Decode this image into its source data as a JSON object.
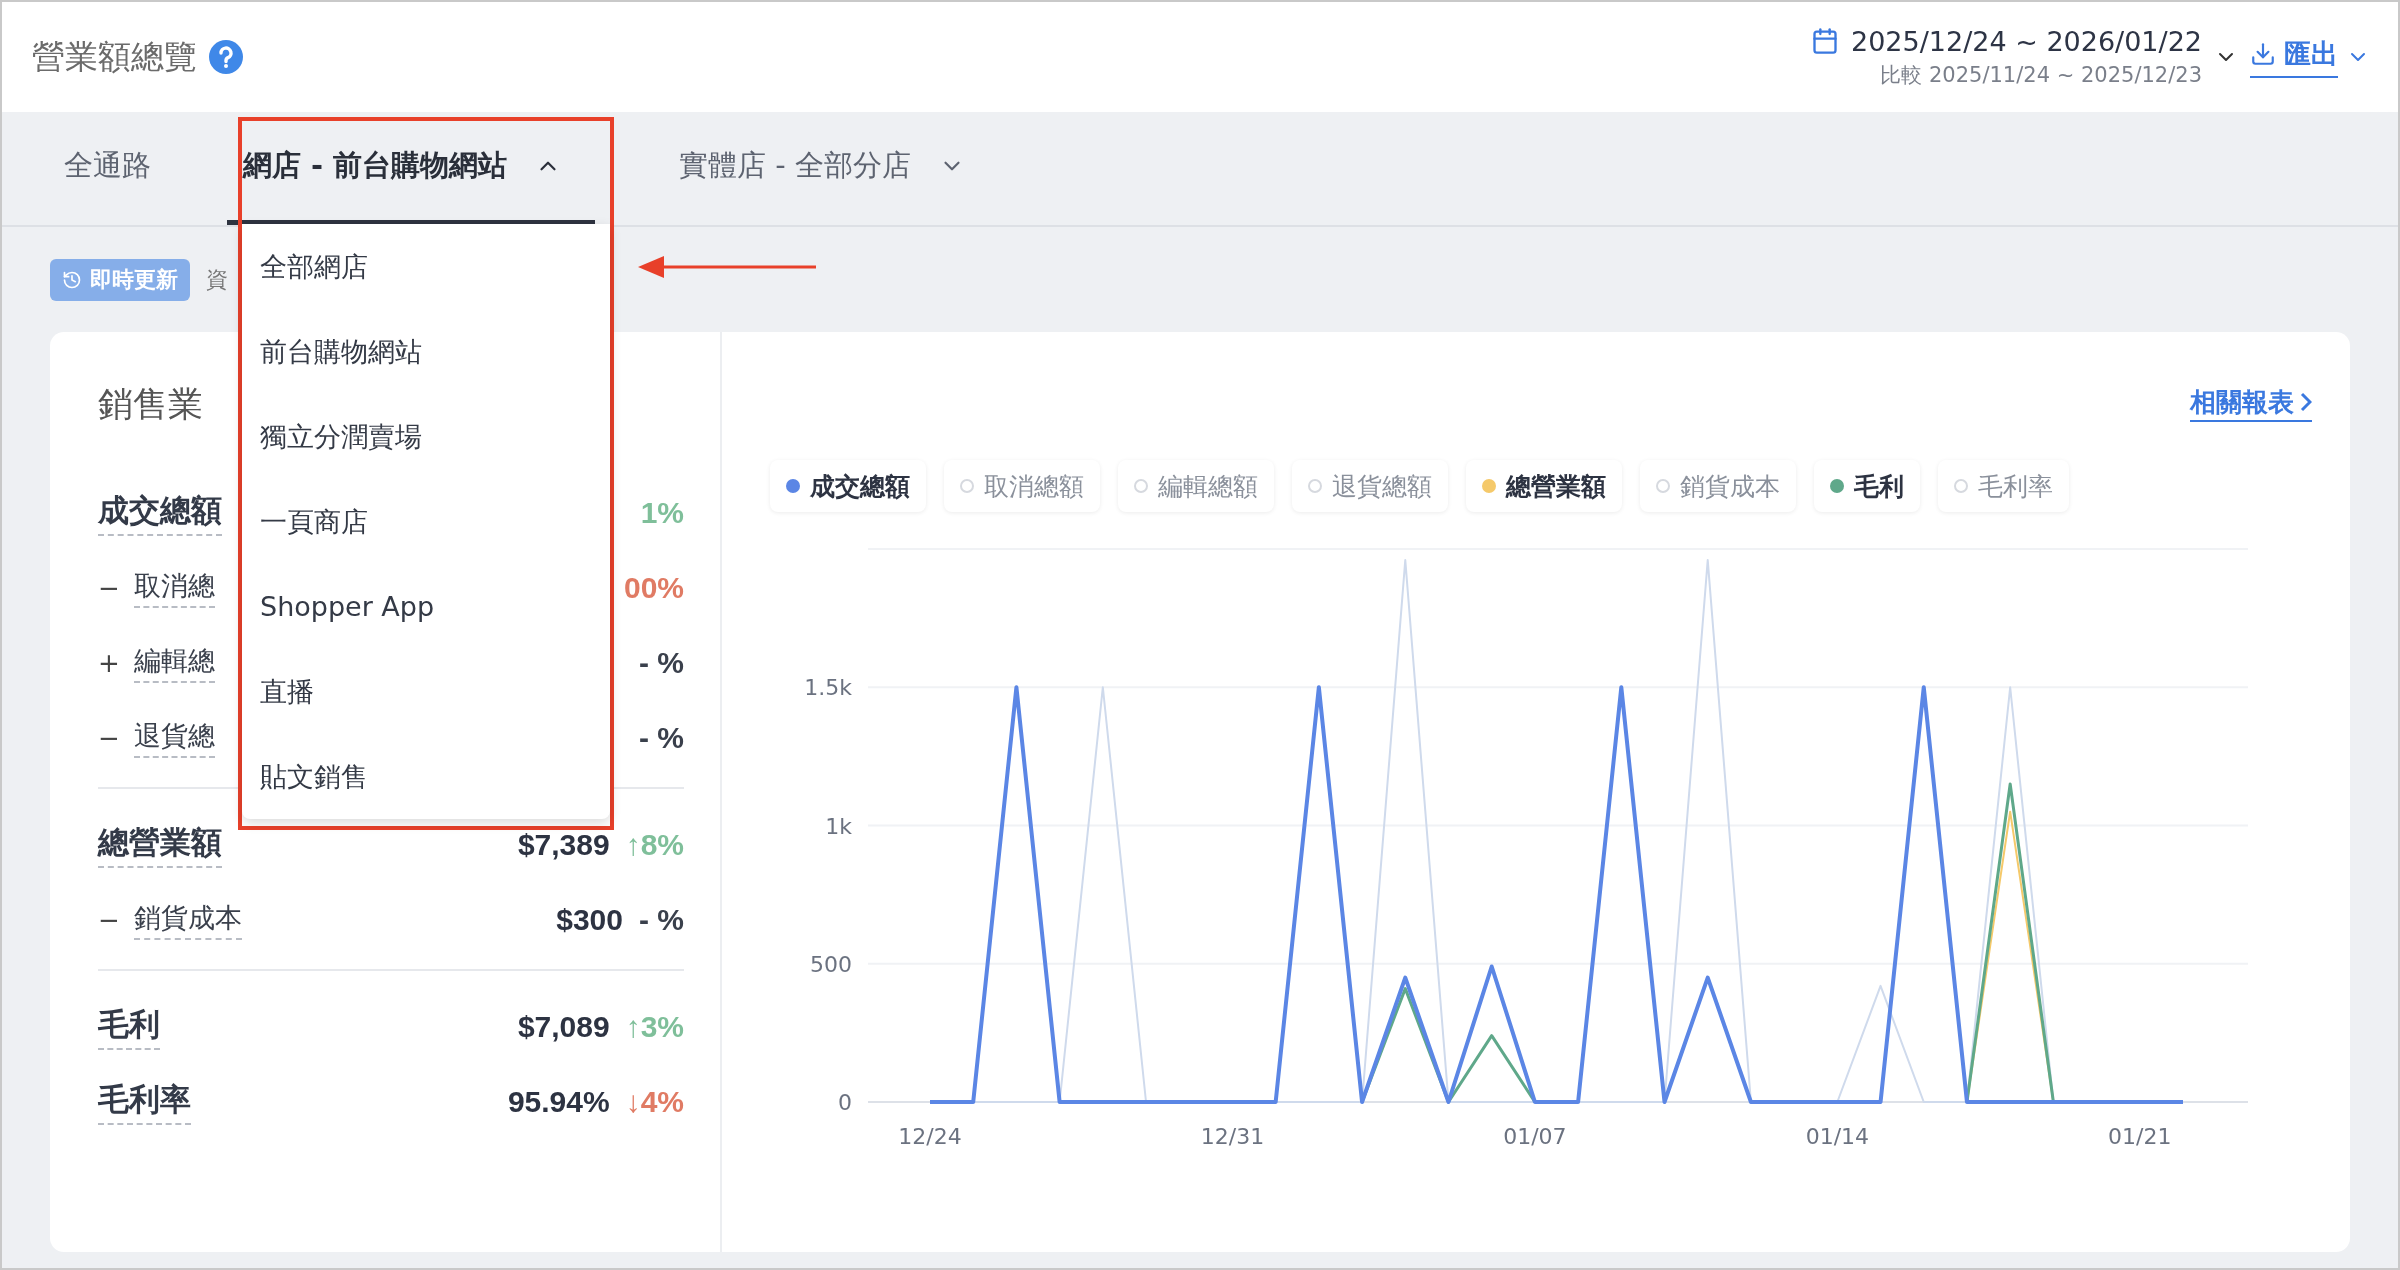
{
  "header": {
    "title": "營業額總覽",
    "date_range": "2025/12/24 ~ 2026/01/22",
    "compare": "比較 2025/11/24 ~ 2025/12/23",
    "export": "匯出"
  },
  "tabs": [
    {
      "label": "全通路",
      "selected": false
    },
    {
      "label": "網店 - 前台購物網站",
      "selected": true,
      "expanded": true
    },
    {
      "label": "實體店 - 全部分店",
      "selected": false,
      "expanded": false
    }
  ],
  "dropdown": {
    "items": [
      "全部網店",
      "前台購物網站",
      "獨立分潤賣場",
      "一頁商店",
      "Shopper App",
      "直播",
      "貼文銷售"
    ]
  },
  "status": {
    "badge": "即時更新",
    "text": "資"
  },
  "summary": {
    "title": "銷售業",
    "rows": [
      {
        "kind": "main",
        "label": "成交總額",
        "change": "1%",
        "color": "#7fbf9a"
      },
      {
        "kind": "sub",
        "sign": "−",
        "label": "取消總",
        "change": "00%",
        "color": "#e07b64"
      },
      {
        "kind": "sub",
        "sign": "+",
        "label": "編輯總",
        "change": "- %"
      },
      {
        "kind": "sub",
        "sign": "−",
        "label": "退貨總",
        "change": "- %"
      },
      {
        "kind": "divider"
      },
      {
        "kind": "main",
        "label": "總營業額",
        "value": "$7,389",
        "change": "↑8%",
        "color": "#7fbf9a"
      },
      {
        "kind": "sub",
        "sign": "−",
        "label": "銷貨成本",
        "value": "$300",
        "change": "- %"
      },
      {
        "kind": "divider"
      },
      {
        "kind": "main",
        "label": "毛利",
        "value": "$7,089",
        "change": "↑3%",
        "color": "#7fbf9a"
      },
      {
        "kind": "main",
        "label": "毛利率",
        "value": "95.94%",
        "change": "↓4%",
        "color": "#e07b64"
      }
    ]
  },
  "report_link": "相關報表",
  "legend": {
    "items": [
      {
        "label": "成交總額",
        "selected": true,
        "color": "#5b86e5"
      },
      {
        "label": "取消總額",
        "selected": false
      },
      {
        "label": "編輯總額",
        "selected": false
      },
      {
        "label": "退貨總額",
        "selected": false
      },
      {
        "label": "總營業額",
        "selected": true,
        "color": "#f5c96a"
      },
      {
        "label": "銷貨成本",
        "selected": false
      },
      {
        "label": "毛利",
        "selected": true,
        "color": "#5fa88a"
      },
      {
        "label": "毛利率",
        "selected": false
      }
    ]
  },
  "chart_data": {
    "type": "line",
    "categories": [
      "12/24",
      null,
      null,
      null,
      null,
      null,
      null,
      "12/31",
      null,
      null,
      null,
      null,
      null,
      null,
      "01/07",
      null,
      null,
      null,
      null,
      null,
      null,
      "01/14",
      null,
      null,
      null,
      null,
      null,
      null,
      "01/21",
      null
    ],
    "yticks": [
      {
        "value": 0,
        "label": "0"
      },
      {
        "value": 500,
        "label": "500"
      },
      {
        "value": 1000,
        "label": "1k"
      },
      {
        "value": 1500,
        "label": "1.5k"
      }
    ],
    "ylim": [
      0,
      2000
    ],
    "grid": true,
    "series": [
      {
        "color": "#cfdaec",
        "values": [
          0,
          0,
          0,
          0,
          1500,
          0,
          0,
          0,
          0,
          0,
          0,
          1960,
          0,
          0,
          0,
          0,
          0,
          0,
          1960,
          0,
          0,
          0,
          420,
          0,
          0,
          1500,
          0,
          0,
          0,
          0
        ]
      },
      {
        "color": "#f5c96a",
        "values": [
          null,
          null,
          null,
          null,
          null,
          null,
          null,
          null,
          null,
          null,
          null,
          null,
          null,
          null,
          null,
          null,
          null,
          null,
          null,
          null,
          null,
          null,
          null,
          null,
          0,
          1050,
          0,
          null,
          null,
          null
        ]
      },
      {
        "color": "#5fa88a",
        "values": [
          null,
          null,
          null,
          null,
          null,
          null,
          null,
          null,
          null,
          null,
          0,
          410,
          0,
          240,
          0,
          null,
          null,
          null,
          null,
          null,
          null,
          null,
          null,
          null,
          0,
          1150,
          0,
          null,
          null,
          null
        ]
      },
      {
        "color": "#5b86e5",
        "values": [
          0,
          0,
          1500,
          0,
          0,
          0,
          0,
          0,
          0,
          1500,
          0,
          450,
          0,
          490,
          0,
          0,
          1500,
          0,
          450,
          0,
          0,
          0,
          0,
          1500,
          0,
          0,
          0,
          0,
          0,
          0
        ]
      }
    ]
  }
}
